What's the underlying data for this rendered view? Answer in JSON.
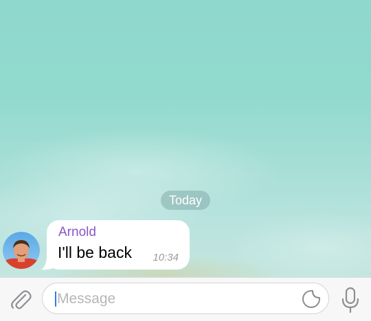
{
  "chat": {
    "date_separator": "Today",
    "messages": [
      {
        "sender": "Arnold",
        "text": "I'll be back",
        "time": "10:34"
      }
    ]
  },
  "composer": {
    "placeholder": "Message",
    "value": ""
  },
  "icons": {
    "attach": "paperclip-icon",
    "sticker": "sticker-icon",
    "mic": "microphone-icon"
  },
  "colors": {
    "sender_name": "#8a55c7",
    "caret": "#2e7ce0",
    "icon_gray": "#8e8e93"
  }
}
